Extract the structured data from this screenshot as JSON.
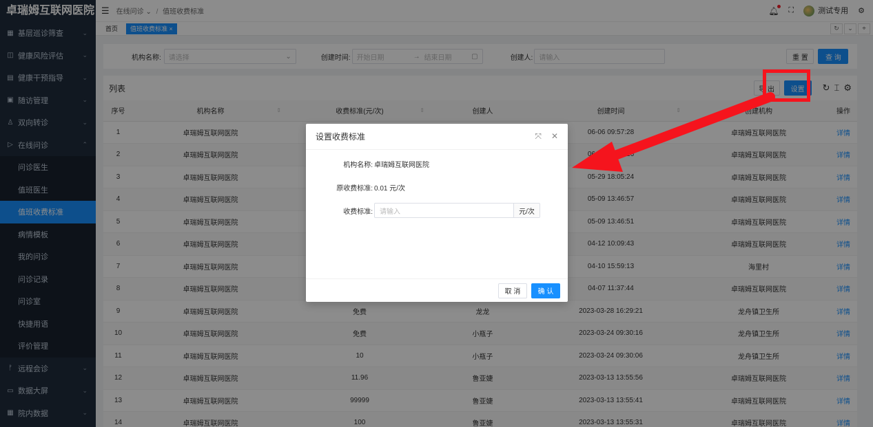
{
  "sidebar": {
    "logo": "卓瑞姆互联网医院",
    "items": [
      {
        "icon": "▦",
        "label": "基层巡诊筛查",
        "arrow": "⌄"
      },
      {
        "icon": "◫",
        "label": "健康风险评估",
        "arrow": "⌄"
      },
      {
        "icon": "▤",
        "label": "健康干预指导",
        "arrow": "⌄"
      },
      {
        "icon": "▣",
        "label": "随访管理",
        "arrow": "⌄"
      },
      {
        "icon": "♙",
        "label": "双向转诊",
        "arrow": "⌄"
      },
      {
        "icon": "▷",
        "label": "在线问诊",
        "arrow": "⌃"
      }
    ],
    "subitems": [
      "问诊医生",
      "值班医生",
      "值班收费标准",
      "病情模板",
      "我的问诊",
      "问诊记录",
      "问诊室",
      "快捷用语",
      "评价管理"
    ],
    "items_after": [
      {
        "icon": "ᚠ",
        "label": "远程会诊",
        "arrow": "⌄"
      },
      {
        "icon": "▭",
        "label": "数据大屏",
        "arrow": "⌄"
      },
      {
        "icon": "▦",
        "label": "院内数据",
        "arrow": "⌄"
      }
    ]
  },
  "header": {
    "breadcrumb_1": "在线问诊",
    "breadcrumb_caret": "⌄",
    "breadcrumb_sep": "/",
    "breadcrumb_2": "值班收费标准",
    "user": "测试专用"
  },
  "tags": {
    "home": "首页",
    "current": "值班收费标准 ×"
  },
  "search": {
    "org_label": "机构名称:",
    "org_placeholder": "请选择",
    "time_label": "创建时间:",
    "start_placeholder": "开始日期",
    "arrow": "→",
    "end_placeholder": "结束日期",
    "creator_label": "创建人:",
    "creator_placeholder": "请输入",
    "reset": "重 置",
    "query": "查 询"
  },
  "list": {
    "title": "列表",
    "export": "导 出",
    "settings": "设置",
    "columns": [
      "序号",
      "机构名称",
      "收费标准(元/次)",
      "创建人",
      "创建时间",
      "创建机构",
      "操作"
    ],
    "rows": [
      {
        "no": "1",
        "org": "卓瑞姆互联网医院",
        "fee": "",
        "creator": "",
        "time": "06-06 09:57:28",
        "corg": "卓瑞姆互联网医院",
        "op": "详情"
      },
      {
        "no": "2",
        "org": "卓瑞姆互联网医院",
        "fee": "",
        "creator": "",
        "time": "06-05 09:38:26",
        "corg": "卓瑞姆互联网医院",
        "op": "详情"
      },
      {
        "no": "3",
        "org": "卓瑞姆互联网医院",
        "fee": "",
        "creator": "",
        "time": "05-29 18:05:24",
        "corg": "卓瑞姆互联网医院",
        "op": "详情"
      },
      {
        "no": "4",
        "org": "卓瑞姆互联网医院",
        "fee": "",
        "creator": "",
        "time": "05-09 13:46:57",
        "corg": "卓瑞姆互联网医院",
        "op": "详情"
      },
      {
        "no": "5",
        "org": "卓瑞姆互联网医院",
        "fee": "",
        "creator": "",
        "time": "05-09 13:46:51",
        "corg": "卓瑞姆互联网医院",
        "op": "详情"
      },
      {
        "no": "6",
        "org": "卓瑞姆互联网医院",
        "fee": "",
        "creator": "",
        "time": "04-12 10:09:43",
        "corg": "卓瑞姆互联网医院",
        "op": "详情"
      },
      {
        "no": "7",
        "org": "卓瑞姆互联网医院",
        "fee": "",
        "creator": "",
        "time": "04-10 15:59:13",
        "corg": "海里村",
        "op": "详情"
      },
      {
        "no": "8",
        "org": "卓瑞姆互联网医院",
        "fee": "",
        "creator": "",
        "time": "04-07 11:37:44",
        "corg": "卓瑞姆互联网医院",
        "op": "详情"
      },
      {
        "no": "9",
        "org": "卓瑞姆互联网医院",
        "fee": "免费",
        "creator": "龙龙",
        "time": "2023-03-28 16:29:21",
        "corg": "龙舟镇卫生所",
        "op": "详情"
      },
      {
        "no": "10",
        "org": "卓瑞姆互联网医院",
        "fee": "免费",
        "creator": "小瓶子",
        "time": "2023-03-24 09:30:16",
        "corg": "龙舟镇卫生所",
        "op": "详情"
      },
      {
        "no": "11",
        "org": "卓瑞姆互联网医院",
        "fee": "10",
        "creator": "小瓶子",
        "time": "2023-03-24 09:30:06",
        "corg": "龙舟镇卫生所",
        "op": "详情"
      },
      {
        "no": "12",
        "org": "卓瑞姆互联网医院",
        "fee": "11.96",
        "creator": "鲁亚婕",
        "time": "2023-03-13 13:55:56",
        "corg": "卓瑞姆互联网医院",
        "op": "详情"
      },
      {
        "no": "13",
        "org": "卓瑞姆互联网医院",
        "fee": "99999",
        "creator": "鲁亚婕",
        "time": "2023-03-13 13:55:41",
        "corg": "卓瑞姆互联网医院",
        "op": "详情"
      },
      {
        "no": "14",
        "org": "卓瑞姆互联网医院",
        "fee": "100",
        "creator": "鲁亚婕",
        "time": "2023-03-13 13:55:31",
        "corg": "卓瑞姆互联网医院",
        "op": "详情"
      }
    ]
  },
  "modal": {
    "title": "设置收费标准",
    "org_label": "机构名称:",
    "org_value": "卓瑞姆互联网医院",
    "orig_label": "原收费标准:",
    "orig_value": "0.01 元/次",
    "fee_label": "收费标准:",
    "fee_placeholder": "请输入",
    "fee_unit": "元/次",
    "cancel": "取 消",
    "confirm": "确 认"
  },
  "colors": {
    "primary": "#1890ff",
    "sidebar": "#1f2d3d",
    "annotation": "#f5141d"
  }
}
